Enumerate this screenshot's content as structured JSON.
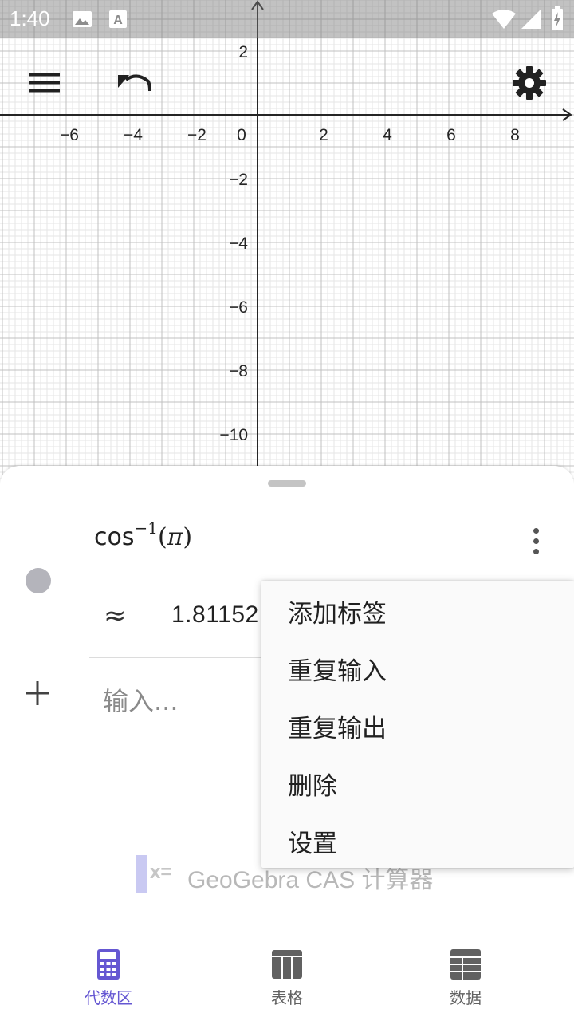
{
  "status_bar": {
    "time": "1:40"
  },
  "toolbar": {
    "menu_icon": "hamburger-menu-icon",
    "undo_icon": "undo-icon",
    "settings_icon": "gear-icon"
  },
  "graph": {
    "x_ticks": [
      "−6",
      "−4",
      "−2",
      "0",
      "2",
      "4",
      "6",
      "8"
    ],
    "y_ticks": [
      "2",
      "−2",
      "−4",
      "−6",
      "−8",
      "−10"
    ]
  },
  "algebra": {
    "expression": {
      "fn": "cos",
      "sup": "−1",
      "open": "(",
      "arg": "π",
      "close": ")"
    },
    "approx_symbol": "≈",
    "result": "1.81152",
    "input_placeholder": "输入..."
  },
  "brand": {
    "x_symbol": "x=",
    "name": "GeoGebra CAS 计算器"
  },
  "context_menu": {
    "items": [
      "添加标签",
      "重复输入",
      "重复输出",
      "删除",
      "设置"
    ]
  },
  "bottom_nav": {
    "items": [
      {
        "label": "代数区",
        "icon": "calculator-icon",
        "active": true
      },
      {
        "label": "表格",
        "icon": "table-icon",
        "active": false
      },
      {
        "label": "数据",
        "icon": "spreadsheet-icon",
        "active": false
      }
    ]
  },
  "colors": {
    "accent": "#6557d2",
    "inactive": "#616161",
    "grid_minor": "#e6e6e6",
    "grid_major": "#c0c0c0"
  }
}
